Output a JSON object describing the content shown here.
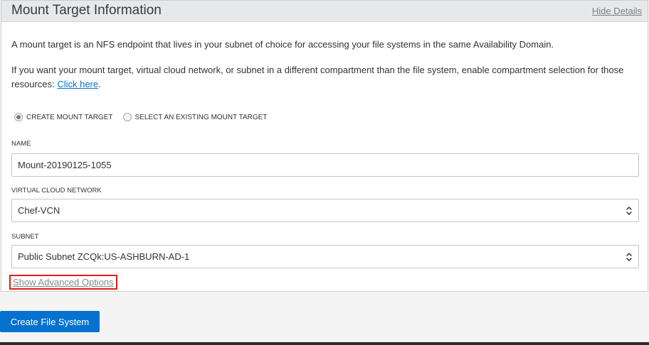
{
  "panel": {
    "title": "Mount Target Information",
    "hide_details": "Hide Details",
    "description": "A mount target is an NFS endpoint that lives in your subnet of choice for accessing your file systems in the same Availability Domain.",
    "compartment_text": "If you want your mount target, virtual cloud network, or subnet in a different compartment than the file system, enable compartment selection for those resources: ",
    "compartment_link": "Click here",
    "compartment_suffix": "."
  },
  "mount_target_mode": {
    "options": [
      {
        "label": "CREATE MOUNT TARGET",
        "selected": true
      },
      {
        "label": "SELECT AN EXISTING MOUNT TARGET",
        "selected": false
      }
    ]
  },
  "fields": {
    "name": {
      "label": "NAME",
      "value": "Mount-20190125-1055"
    },
    "vcn": {
      "label": "VIRTUAL CLOUD NETWORK",
      "value": "Chef-VCN"
    },
    "subnet": {
      "label": "SUBNET",
      "value": "Public Subnet ZCQk:US-ASHBURN-AD-1"
    }
  },
  "advanced_options_link": "Show Advanced Options",
  "create_button": "Create File System",
  "colors": {
    "accent": "#0572ce",
    "highlight_border": "#e01c1c",
    "header_bg": "#e6e8ea"
  },
  "icons": {
    "select_stepper": "chevron-up-down-icon"
  }
}
